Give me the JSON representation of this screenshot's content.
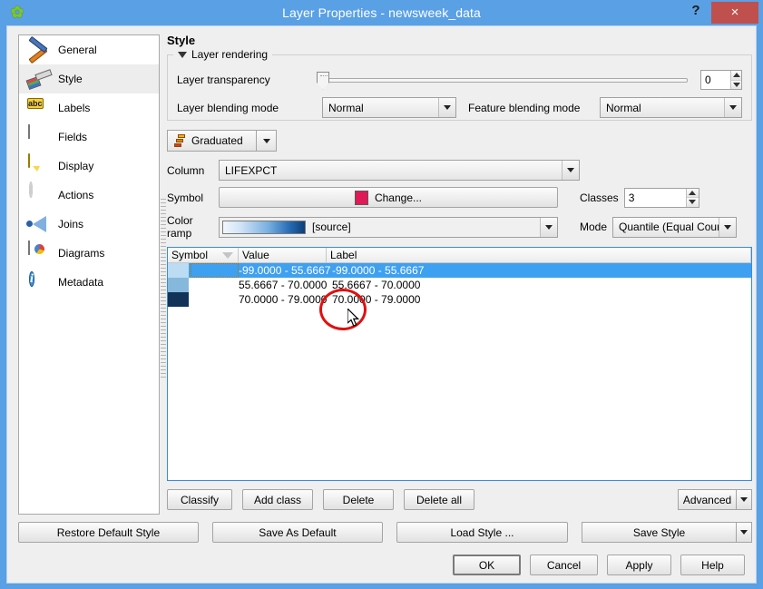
{
  "window": {
    "title": "Layer Properties - newsweek_data",
    "app_icon": "qgis-leaf-icon",
    "help_label": "?",
    "close_label": "×"
  },
  "sidebar": {
    "items": [
      {
        "label": "General",
        "icon": "hammer-wrench-icon",
        "selected": false
      },
      {
        "label": "Style",
        "icon": "paintbrush-icon",
        "selected": true
      },
      {
        "label": "Labels",
        "icon": "abc-label-icon",
        "selected": false
      },
      {
        "label": "Fields",
        "icon": "table-fields-icon",
        "selected": false
      },
      {
        "label": "Display",
        "icon": "speech-bubble-icon",
        "selected": false
      },
      {
        "label": "Actions",
        "icon": "gear-play-icon",
        "selected": false
      },
      {
        "label": "Joins",
        "icon": "join-arrow-icon",
        "selected": false
      },
      {
        "label": "Diagrams",
        "icon": "pie-map-icon",
        "selected": false
      },
      {
        "label": "Metadata",
        "icon": "info-circle-icon",
        "selected": false
      }
    ]
  },
  "style_panel": {
    "heading": "Style",
    "rendering": {
      "group_title": "Layer rendering",
      "transparency_label": "Layer transparency",
      "transparency_value": "0",
      "layer_blending_label": "Layer blending mode",
      "layer_blending_value": "Normal",
      "feature_blending_label": "Feature blending mode",
      "feature_blending_value": "Normal"
    },
    "renderer": {
      "label": "Graduated",
      "icon": "graduated-ramp-icon"
    },
    "column_label": "Column",
    "column_value": "LIFEXPCT",
    "symbol_label": "Symbol",
    "symbol_change_label": "Change...",
    "symbol_color": "#e01a57",
    "color_ramp_label": "Color ramp",
    "color_ramp_value": "[source]",
    "classes_label": "Classes",
    "classes_value": "3",
    "mode_label": "Mode",
    "mode_value": "Quantile (Equal Count)"
  },
  "table": {
    "columns": [
      "Symbol",
      "Value",
      "Label"
    ],
    "sort_column": "Symbol",
    "rows": [
      {
        "color": "#bcdcf4",
        "value": "-99.0000 - 55.6667",
        "label": "-99.0000 - 55.6667",
        "selected": true
      },
      {
        "color": "#86b8dc",
        "value": "55.6667 - 70.0000",
        "label": "55.6667 - 70.0000",
        "selected": false
      },
      {
        "color": "#123258",
        "value": "70.0000 - 79.0000",
        "label": "70.0000 - 79.0000",
        "selected": false
      }
    ]
  },
  "class_buttons": {
    "classify": "Classify",
    "add_class": "Add class",
    "delete": "Delete",
    "delete_all": "Delete all",
    "advanced": "Advanced"
  },
  "style_buttons": {
    "restore_default": "Restore Default Style",
    "save_as_default": "Save As Default",
    "load_style": "Load Style ...",
    "save_style": "Save Style"
  },
  "dialog_buttons": {
    "ok": "OK",
    "cancel": "Cancel",
    "apply": "Apply",
    "help": "Help"
  },
  "annotation": {
    "type": "red-ellipse-highlight",
    "color": "#e01010"
  }
}
